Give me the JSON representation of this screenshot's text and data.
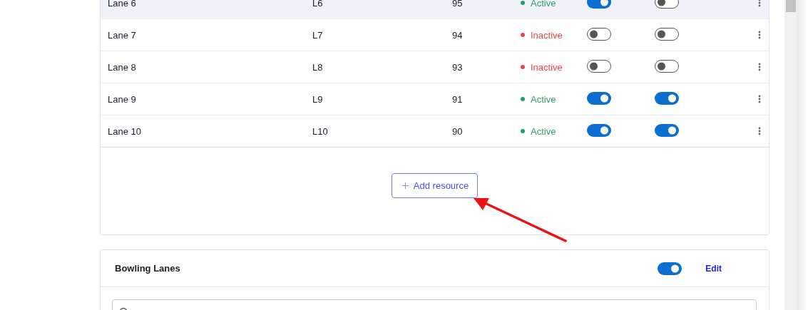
{
  "resources_table": {
    "rows": [
      {
        "name": "Lane 6",
        "code": "L6",
        "value": "95",
        "status": "Active",
        "active": true,
        "toggle_1": true,
        "toggle_2": false,
        "hovered": true
      },
      {
        "name": "Lane 7",
        "code": "L7",
        "value": "94",
        "status": "Inactive",
        "active": false,
        "toggle_1": false,
        "toggle_2": false,
        "hovered": false
      },
      {
        "name": "Lane 8",
        "code": "L8",
        "value": "93",
        "status": "Inactive",
        "active": false,
        "toggle_1": false,
        "toggle_2": false,
        "hovered": false
      },
      {
        "name": "Lane 9",
        "code": "L9",
        "value": "91",
        "status": "Active",
        "active": true,
        "toggle_1": true,
        "toggle_2": true,
        "hovered": false
      },
      {
        "name": "Lane 10",
        "code": "L10",
        "value": "90",
        "status": "Active",
        "active": true,
        "toggle_1": true,
        "toggle_2": true,
        "hovered": false
      }
    ],
    "add_button": {
      "label": "Add resource"
    }
  },
  "bowling_lanes_card": {
    "title": "Bowling Lanes",
    "enabled": true,
    "edit_link": "Edit"
  }
}
